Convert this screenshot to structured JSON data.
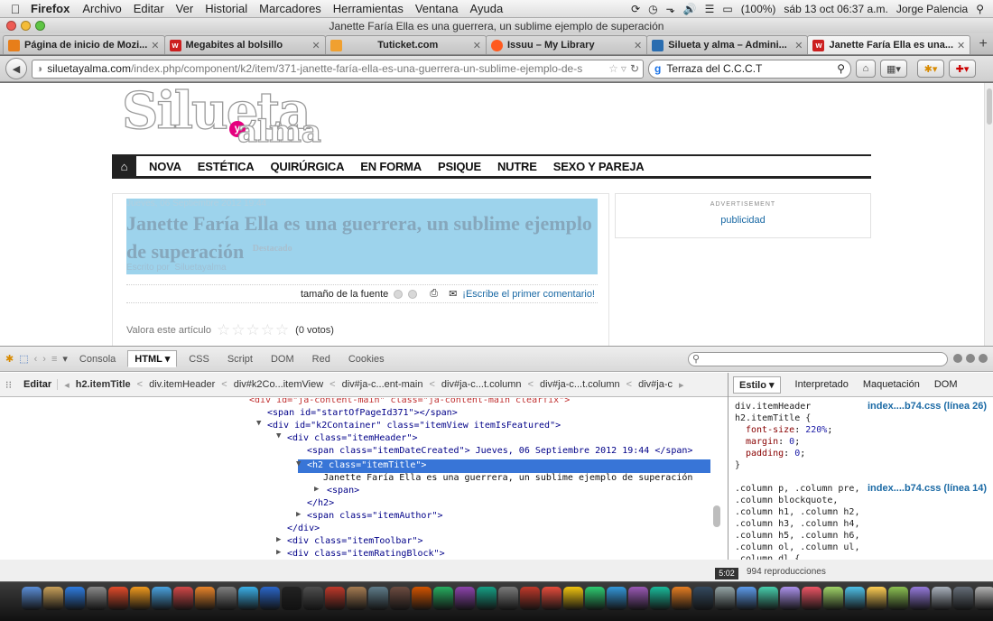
{
  "menubar": {
    "app": "Firefox",
    "items": [
      "Archivo",
      "Editar",
      "Ver",
      "Historial",
      "Marcadores",
      "Herramientas",
      "Ventana",
      "Ayuda"
    ],
    "battery": "(100%)",
    "clock": "sáb 13 oct  06:37 a.m.",
    "user": "Jorge Palencia"
  },
  "window": {
    "title": "Janette Faría Ella es una guerrera, un sublime ejemplo de superación"
  },
  "tabs": [
    {
      "label": "Página de inicio de Mozi...",
      "icon": "firefox-icon",
      "color": "#e77e1a",
      "has_close": true
    },
    {
      "label": "Megabites al bolsillo",
      "icon": "w-icon",
      "color": "#cc1f1f",
      "has_close": true
    },
    {
      "label": "Tuticket.com",
      "icon": "ticket-icon",
      "color": "#f0a030",
      "has_close": true
    },
    {
      "label": "Issuu – My Library",
      "icon": "issuu-icon",
      "color": "#ff5a1f",
      "has_close": true
    },
    {
      "label": "Silueta y alma – Admini...",
      "icon": "joomla-icon",
      "color": "#2a6db0",
      "has_close": true
    },
    {
      "label": "Janette Faría Ella es una...",
      "icon": "w-icon",
      "color": "#cc1f1f",
      "has_close": true,
      "active": true
    }
  ],
  "navbar": {
    "url_domain": "siluetayalma.com",
    "url_path": "/index.php/component/k2/item/371-janette-faría-ella-es-una-guerrera-un-sublime-ejemplo-de-s",
    "search_value": "Terraza del C.C.C.T"
  },
  "site": {
    "nav": [
      "NOVA",
      "ESTÉTICA",
      "QUIRÚRGICA",
      "EN FORMA",
      "PSIQUE",
      "NUTRE",
      "SEXO Y PAREJA"
    ],
    "article": {
      "date": "Jueves, 06 Septiembre 2012 19:44",
      "title": "Janette Faría Ella es una guerrera, un sublime ejemplo de superación",
      "featured": "Destacado",
      "author_label": "Escrito por",
      "author": "Siluetayalma",
      "font_size_label": "tamaño de la fuente",
      "comment_link": "¡Escribe el primer comentario!",
      "rating_label": "Valora este artículo",
      "votes": "(0 votos)"
    },
    "ad": {
      "label": "ADVERTISEMENT",
      "link": "publicidad"
    }
  },
  "firebug": {
    "tabs": [
      "Consola",
      "HTML",
      "CSS",
      "Script",
      "DOM",
      "Red",
      "Cookies"
    ],
    "active_tab": "HTML",
    "edit_label": "Editar",
    "breadcrumbs": [
      "h2.itemTitle",
      "div.itemHeader",
      "div#k2Co...itemView",
      "div#ja-c...ent-main",
      "div#ja-c...t.column",
      "div#ja-c...t.column",
      "div#ja-c"
    ],
    "side_tabs": [
      "Estilo",
      "Interpretado",
      "Maquetación",
      "DOM"
    ],
    "html_lines": [
      {
        "twisty": "",
        "tag_open": "<div id=\"ja-content-main\" class=\"ja-content-main clearfix\">"
      },
      {
        "twisty": "",
        "tag_open": "<span id=\"startOfPageId371\"></span>"
      },
      {
        "twisty": "▼",
        "tag_open": "<div id=\"k2Container\" class=\"itemView itemIsFeatured\">"
      },
      {
        "twisty": "▼",
        "tag_open": "<div class=\"itemHeader\">"
      },
      {
        "twisty": "",
        "tag_open": "<span class=\"itemDateCreated\"> Jueves, 06 Septiembre 2012 19:44 </span>"
      },
      {
        "twisty": "▼",
        "tag_open": "<h2 class=\"itemTitle\">"
      },
      {
        "twisty": "",
        "tag_open": "Janette Faría Ella es una guerrera, un sublime ejemplo de superación"
      },
      {
        "twisty": "▶",
        "tag_open": "<span>"
      },
      {
        "twisty": "",
        "tag_open": "</h2>"
      },
      {
        "twisty": "▶",
        "tag_open": "<span class=\"itemAuthor\">"
      },
      {
        "twisty": "",
        "tag_open": "</div>"
      },
      {
        "twisty": "▶",
        "tag_open": "<div class=\"itemToolbar\">"
      },
      {
        "twisty": "▶",
        "tag_open": "<div class=\"itemRatingBlock\">"
      }
    ],
    "css_rules": [
      {
        "selector": "div.itemHeader",
        "selector2": "h2.itemTitle {",
        "source": "index....b74.css (línea 26)",
        "props": [
          [
            "font-size",
            "220%"
          ],
          [
            "margin",
            "0"
          ],
          [
            "padding",
            "0"
          ]
        ]
      },
      {
        "selector": ".column p, .column pre,",
        "source": "index....b74.css (línea 14)",
        "more": [
          ".column blockquote,",
          ".column h1, .column h2,",
          ".column h3, .column h4,",
          ".column h5, .column h6,",
          ".column ol, .column ul,",
          ".column dl {"
        ]
      }
    ]
  },
  "background_window": {
    "time": "5:02",
    "plays": "994 reproducciones"
  }
}
